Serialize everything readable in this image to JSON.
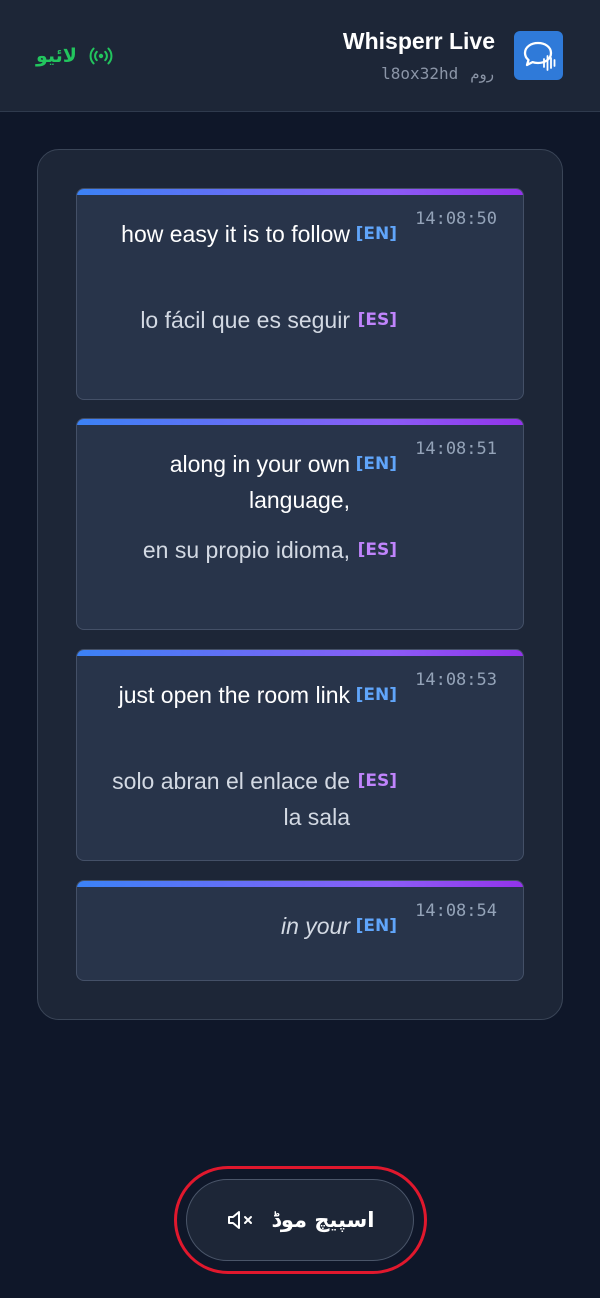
{
  "header": {
    "app_title": "Whisperr Live",
    "room_id": "l8ox32hd",
    "room_label": "روم",
    "live_label": "لائیو",
    "logo_icon": "chat-waveform-icon",
    "live_icon": "broadcast-icon"
  },
  "cards": [
    {
      "time": "14:08:50",
      "source_text": "how easy it is to follow",
      "source_lang": "[EN]",
      "translation_text": "lo fácil que es seguir",
      "translation_lang": "[ES]"
    },
    {
      "time": "14:08:51",
      "source_text": "along in your own language,",
      "source_lang": "[EN]",
      "translation_text": "en su propio idioma,",
      "translation_lang": "[ES]"
    },
    {
      "time": "14:08:53",
      "source_text": "just open the room link",
      "source_lang": "[EN]",
      "translation_text": "solo abran el enlace de la sala",
      "translation_lang": "[ES]"
    },
    {
      "time": "14:08:54",
      "source_text": "in your",
      "source_lang": "[EN]",
      "interim": true
    }
  ],
  "speak_button": {
    "label": "اسپیچ موڈ",
    "icon": "speaker-muted-icon"
  },
  "colors": {
    "background": "#0f1729",
    "panel": "#1d2637",
    "card": "#28344a",
    "live_green": "#22c55e",
    "lang_en": "#60a5fa",
    "lang_es": "#c084fc",
    "accent_blue": "#3b82f6",
    "accent_purple": "#9333ea",
    "highlight_red": "#e0182d"
  }
}
